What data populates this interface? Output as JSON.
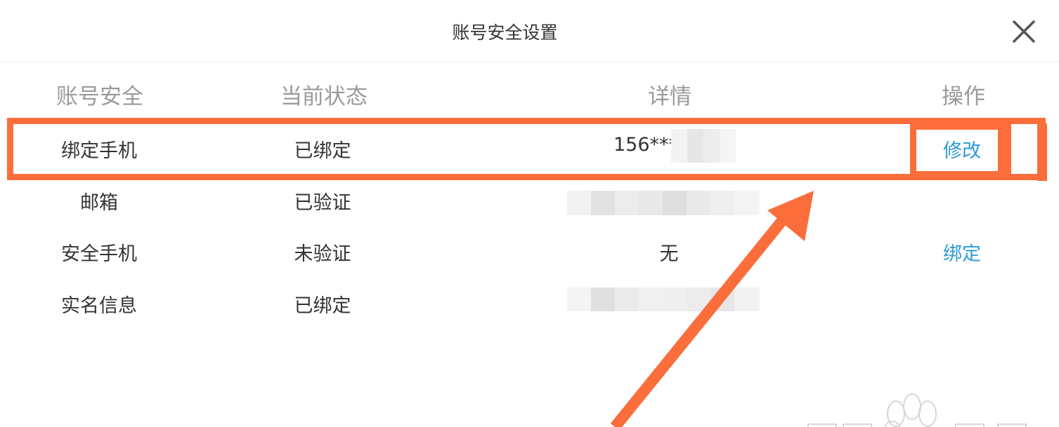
{
  "dialog": {
    "title": "账号安全设置"
  },
  "columns": [
    "账号安全",
    "当前状态",
    "详情",
    "操作"
  ],
  "rows": [
    {
      "name": "绑定手机",
      "status": "已绑定",
      "detail": "156***",
      "action": "修改"
    },
    {
      "name": "邮箱",
      "status": "已验证",
      "detail": "",
      "action": ""
    },
    {
      "name": "安全手机",
      "status": "未验证",
      "detail": "无",
      "action": "绑定"
    },
    {
      "name": "实名信息",
      "status": "已绑定",
      "detail": "",
      "action": ""
    }
  ],
  "colors": {
    "link": "#2d9bd8",
    "highlight": "#fb6e3b",
    "header_text": "#9a9a9a",
    "body_text": "#333333"
  },
  "icons": [
    "close-icon",
    "annotation-arrow-icon",
    "watermark-paw-icon"
  ]
}
